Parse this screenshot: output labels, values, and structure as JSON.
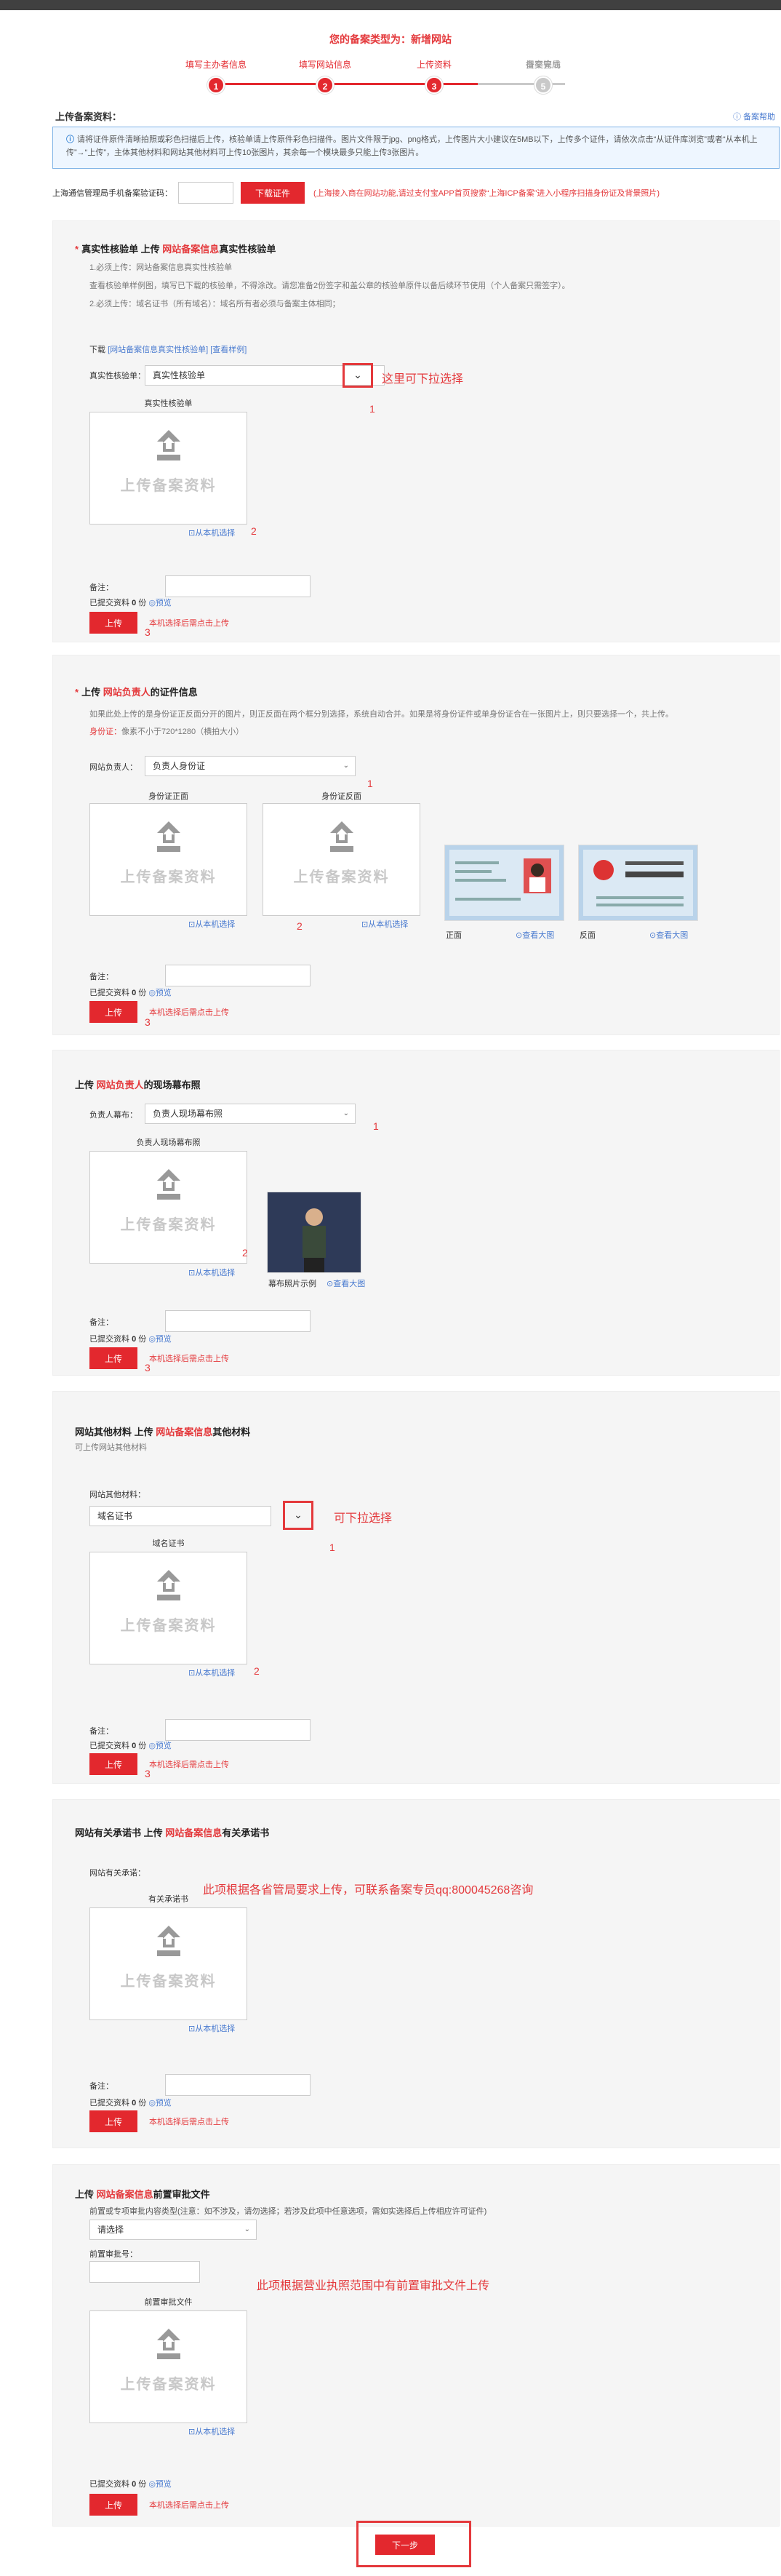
{
  "header": {
    "prefix": "您的备案类型为：",
    "type": "新增网站"
  },
  "steps": [
    {
      "label": "填写主办者信息",
      "num": "1",
      "done": true
    },
    {
      "label": "填写网站信息",
      "num": "2",
      "done": true
    },
    {
      "label": "上传资料",
      "num": "3",
      "done": true
    },
    {
      "label": "提交管局",
      "num": "4",
      "done": false
    },
    {
      "label": "备案完成",
      "num": "5",
      "done": false
    }
  ],
  "section_title": "上传备案资料：",
  "help_link": "备案帮助",
  "notice": "请将证件原件清晰拍照或彩色扫描后上传，核验单请上传原件彩色扫描件。图片文件限于jpg、png格式，上传图片大小建议在5MB以下，上传多个证件，请依次点击“从证件库浏览”或者“从本机上传”→“上传”，主体其他材料和网站其他材料可上传10张图片，其余每一个模块最多只能上传3张图片。",
  "verify": {
    "label": "上海通信管理局手机备案验证码：",
    "button": "下载证件",
    "tip": "(上海接入商在网站功能,请过支付宝APP首页搜索“上海ICP备案”进入小程序扫描身份证及背景照片)"
  },
  "common": {
    "upload_text": "上传备案资料",
    "local_select": "从本机选择",
    "remark": "备注：",
    "submitted": "已提交资料",
    "zero": "0",
    "count_unit": "份",
    "preview": "预览",
    "upload": "上传",
    "upload_tip": "本机选择后需点击上传"
  },
  "panel1": {
    "title_pre": "真实性核验单 上传 ",
    "title_red": "网站备案信息",
    "title_post": "真实性核验单",
    "note1": "1.必须上传：网站备案信息真实性核验单",
    "note1b": "查看核验单样例图，填写已下载的核验单，不得涂改。请您准备2份签字和盖公章的核验单原件以备后续环节使用（个人备案只需签字）。",
    "note2": "2.必须上传：域名证书（所有域名）：域名所有者必须与备案主体相同；",
    "download_label": "下载",
    "download_link1": "[网站备案信息真实性核验单]",
    "download_link2": "[查看样例]",
    "select_label": "真实性核验单：",
    "select_value": "真实性核验单",
    "anno": "这里可下拉选择",
    "box_caption": "真实性核验单"
  },
  "panel2": {
    "title_pre": "上传 ",
    "title_red": "网站负责人",
    "title_post": "的证件信息",
    "note": "如果此处上传的是身份证正反面分开的图片，则正反面在两个框分别选择，系统自动合并。如果是将身份证件或单身份证合在一张图片上，则只要选择一个，共上传。",
    "req_red": "身份证：",
    "req": "像素不小于720*1280（横拍大小）",
    "select_label": "网站负责人：",
    "select_value": "负责人身份证",
    "front": "身份证正面",
    "back": "身份证反面",
    "sample_front": "正面",
    "sample_back": "反面",
    "view_large": "查看大图"
  },
  "panel3": {
    "title_pre": "上传 ",
    "title_red": "网站负责人",
    "title_post": "的现场幕布照",
    "select_label": "负责人幕布：",
    "select_value": "负责人现场幕布照",
    "box_caption": "负责人现场幕布照",
    "sample_caption": "幕布照片示例",
    "view_large": "查看大图"
  },
  "panel4": {
    "title_pre": "网站其他材料 上传 ",
    "title_red": "网站备案信息",
    "title_post": "其他材料",
    "sub": "可上传网站其他材料",
    "select_label": "网站其他材料：",
    "select_value": "域名证书",
    "anno": "可下拉选择",
    "box_caption": "域名证书"
  },
  "panel5": {
    "title_pre": "网站有关承诺书 上传 ",
    "title_red": "网站备案信息",
    "title_post": "有关承诺书",
    "select_label": "网站有关承诺：",
    "anno": "此项根据各省管局要求上传，可联系备案专员qq:800045268咨询",
    "box_caption": "有关承诺书"
  },
  "panel6": {
    "title_pre": "上传 ",
    "title_red": "网站备案信息",
    "title_post": "前置审批文件",
    "note": "前置或专项审批内容类型(注意：如不涉及，请勿选择；若涉及此项中任意选项，需如实选择后上传相应许可证件)",
    "select_value": "请选择",
    "num_label": "前置审批号：",
    "anno": "此项根据营业执照范围中有前置审批文件上传",
    "box_caption": "前置审批文件"
  },
  "next": "下一步",
  "colors": {
    "accent": "#e3282e",
    "done": "#e3282e",
    "todo": "#c9c9c9",
    "link": "#4a7bd0"
  }
}
